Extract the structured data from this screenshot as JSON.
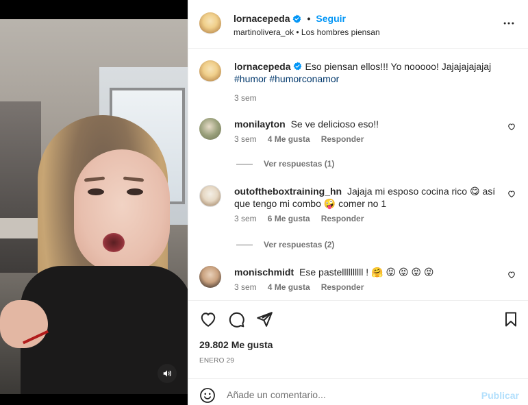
{
  "post": {
    "username": "lornacepeda",
    "follow_label": "Seguir",
    "dot": "•",
    "subtitle": "martinolivera_ok • Los hombres piensan",
    "more_icon": "more-horizontal-icon"
  },
  "caption": {
    "username": "lornacepeda",
    "text": "Eso piensan ellos!!! Yo nooooo! Jajajajajajaj",
    "hashtags": "#humor #humorconamor",
    "time": "3 sem"
  },
  "comments": [
    {
      "username": "monilayton",
      "text": "Se ve delicioso eso!!",
      "time": "3 sem",
      "likes": "4 Me gusta",
      "reply_label": "Responder",
      "view_replies": "Ver respuestas (1)"
    },
    {
      "username": "outoftheboxtraining_hn",
      "text": "Jajaja mi esposo cocina rico 😋 así que tengo mi combo 🤪 comer no 1",
      "time": "3 sem",
      "likes": "6 Me gusta",
      "reply_label": "Responder",
      "view_replies": "Ver respuestas (2)"
    },
    {
      "username": "monischmidt",
      "text": "Ese pastellllllllll ! 🤗 😝 😝 😝 😝",
      "time": "3 sem",
      "likes": "4 Me gusta",
      "reply_label": "Responder"
    }
  ],
  "footer": {
    "likes": "29.802 Me gusta",
    "date": "ENERO 29",
    "comment_placeholder": "Añade un comentario...",
    "post_label": "Publicar"
  },
  "colors": {
    "accent": "#0095f6",
    "post_disabled": "#b2dffc",
    "muted": "#737373",
    "verified": "#0095f6"
  }
}
